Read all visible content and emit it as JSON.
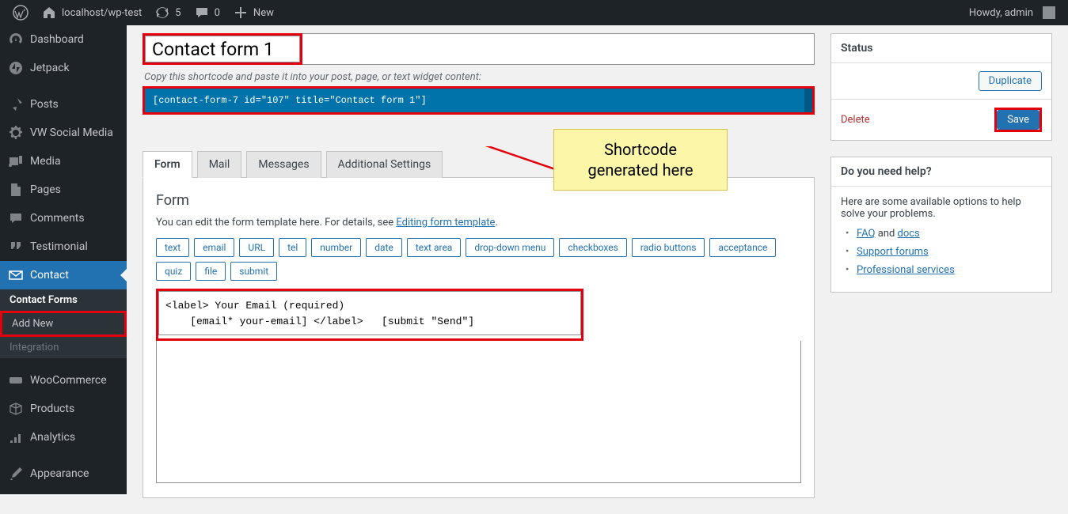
{
  "adminbar": {
    "site": "localhost/wp-test",
    "updates": "5",
    "comments": "0",
    "new": "New",
    "howdy": "Howdy, admin"
  },
  "sidebar": {
    "dashboard": "Dashboard",
    "jetpack": "Jetpack",
    "posts": "Posts",
    "vwsocial": "VW Social Media",
    "media": "Media",
    "pages": "Pages",
    "comments": "Comments",
    "testimonial": "Testimonial",
    "contact": "Contact",
    "contact_forms": "Contact Forms",
    "add_new": "Add New",
    "integration": "Integration",
    "woocommerce": "WooCommerce",
    "products": "Products",
    "analytics": "Analytics",
    "appearance": "Appearance"
  },
  "editor": {
    "title": "Contact form 1",
    "hint": "Copy this shortcode and paste it into your post, page, or text widget content:",
    "shortcode": "[contact-form-7 id=\"107\" title=\"Contact form 1\"]",
    "annotation_l1": "Shortcode",
    "annotation_l2": "generated here"
  },
  "tabs": {
    "form": "Form",
    "mail": "Mail",
    "messages": "Messages",
    "additional": "Additional Settings"
  },
  "form_panel": {
    "heading": "Form",
    "desc_pre": "You can edit the form template here. For details, see ",
    "desc_link": "Editing form template",
    "desc_post": ".",
    "tags": [
      "text",
      "email",
      "URL",
      "tel",
      "number",
      "date",
      "text area",
      "drop-down menu",
      "checkboxes",
      "radio buttons",
      "acceptance",
      "quiz",
      "file",
      "submit"
    ],
    "code": "<label> Your Email (required)\n    [email* your-email] </label>   [submit \"Send\"]"
  },
  "status": {
    "title": "Status",
    "duplicate": "Duplicate",
    "delete": "Delete",
    "save": "Save"
  },
  "help": {
    "title": "Do you need help?",
    "desc": "Here are some available options to help solve your problems.",
    "faq": "FAQ",
    "and": " and ",
    "docs": "docs",
    "support": "Support forums",
    "pro": "Professional services"
  }
}
